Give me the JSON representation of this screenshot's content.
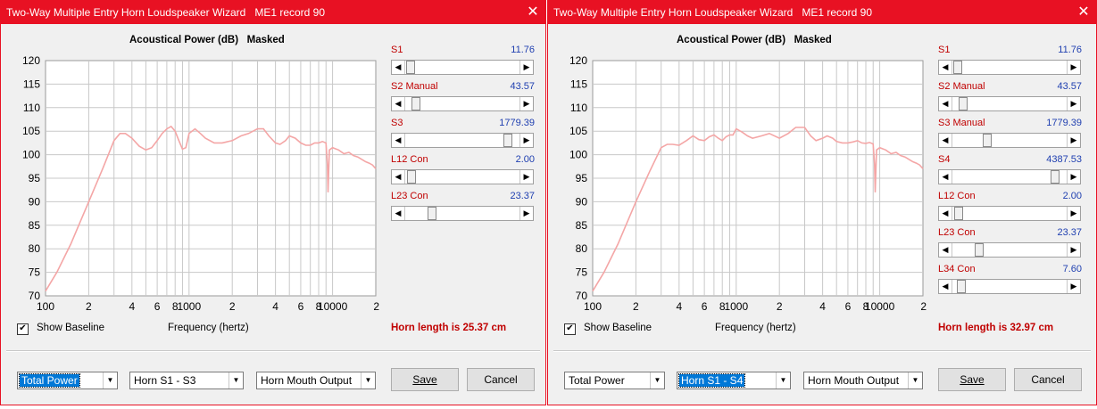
{
  "windows": [
    {
      "title": "Two-Way Multiple Entry Horn Loudspeaker Wizard   ME1 record 90",
      "chart_title": "Acoustical Power (dB)   Masked",
      "sliders": [
        {
          "label": "S1",
          "value": "11.76",
          "position": 0.01
        },
        {
          "label": "S2  Manual",
          "value": "43.57",
          "position": 0.06
        },
        {
          "label": "S3",
          "value": "1779.39",
          "position": 0.92
        },
        {
          "label": "L12  Con",
          "value": "2.00",
          "position": 0.02
        },
        {
          "label": "L23  Con",
          "value": "23.37",
          "position": 0.21
        }
      ],
      "show_baseline_checked": true,
      "show_baseline_label": "Show Baseline",
      "frequency_label": "Frequency (hertz)",
      "horn_length": "Horn length is 25.37 cm",
      "combos": [
        {
          "value": "Total Power",
          "selected": true
        },
        {
          "value": "Horn S1 - S3",
          "selected": false
        },
        {
          "value": "Horn Mouth Output",
          "selected": false
        }
      ],
      "save_label": "Save",
      "cancel_label": "Cancel"
    },
    {
      "title": "Two-Way Multiple Entry Horn Loudspeaker Wizard   ME1 record 90",
      "chart_title": "Acoustical Power (dB)   Masked",
      "sliders": [
        {
          "label": "S1",
          "value": "11.76",
          "position": 0.01
        },
        {
          "label": "S2  Manual",
          "value": "43.57",
          "position": 0.06
        },
        {
          "label": "S3  Manual",
          "value": "1779.39",
          "position": 0.28
        },
        {
          "label": "S4",
          "value": "4387.53",
          "position": 0.92
        },
        {
          "label": "L12  Con",
          "value": "2.00",
          "position": 0.02
        },
        {
          "label": "L23  Con",
          "value": "23.37",
          "position": 0.21
        },
        {
          "label": "L34  Con",
          "value": "7.60",
          "position": 0.04
        }
      ],
      "show_baseline_checked": true,
      "show_baseline_label": "Show Baseline",
      "frequency_label": "Frequency (hertz)",
      "horn_length": "Horn length is 32.97 cm",
      "combos": [
        {
          "value": "Total Power",
          "selected": false
        },
        {
          "value": "Horn S1 - S4",
          "selected": true
        },
        {
          "value": "Horn Mouth Output",
          "selected": false
        }
      ],
      "save_label": "Save",
      "cancel_label": "Cancel"
    }
  ],
  "chart_data": [
    {
      "type": "line",
      "title": "Acoustical Power (dB)   Masked",
      "xlabel": "Frequency (hertz)",
      "ylabel": "",
      "xscale": "log",
      "xlim": [
        100,
        20000
      ],
      "ylim": [
        70,
        120
      ],
      "yticks": [
        "120",
        "115",
        "110",
        "105",
        "100",
        "95",
        "90",
        "85",
        "80",
        "75",
        "70"
      ],
      "xticks": [
        "100",
        "2",
        "4",
        "6",
        "8",
        "1000",
        "2",
        "4",
        "6",
        "8",
        "10000",
        "2"
      ],
      "line_color": "#f4a6a6",
      "series": [
        {
          "x": [
            100,
            120,
            150,
            200,
            250,
            300,
            330,
            360,
            400,
            450,
            500,
            550,
            600,
            650,
            700,
            750,
            800,
            850,
            900,
            950,
            1000,
            1100,
            1200,
            1300,
            1500,
            1700,
            2000,
            2300,
            2600,
            3000,
            3300,
            3600,
            4000,
            4300,
            4700,
            5000,
            5500,
            6000,
            6500,
            7000,
            7500,
            8000,
            8500,
            9000,
            9200,
            9300,
            9500,
            10000,
            11000,
            12000,
            13000,
            14000,
            15000,
            16000,
            17000,
            18000,
            19000,
            20000
          ],
          "y": [
            71,
            75,
            81,
            90,
            97,
            103,
            104.5,
            104.5,
            103.5,
            101.8,
            101,
            101.5,
            103,
            104.5,
            105.5,
            106,
            105,
            103,
            101.2,
            101.5,
            104.5,
            105.5,
            104.5,
            103.5,
            102.5,
            102.5,
            103,
            104,
            104.5,
            105.5,
            105.5,
            104,
            102.5,
            102.2,
            103,
            104,
            103.5,
            102.5,
            102,
            102,
            102.5,
            102.5,
            102.8,
            102.5,
            98,
            92,
            101,
            101.5,
            101,
            100.2,
            100.5,
            99.8,
            99.5,
            99,
            98.5,
            98.2,
            97.8,
            97
          ]
        }
      ]
    },
    {
      "type": "line",
      "title": "Acoustical Power (dB)   Masked",
      "xlabel": "Frequency (hertz)",
      "ylabel": "",
      "xscale": "log",
      "xlim": [
        100,
        20000
      ],
      "ylim": [
        70,
        120
      ],
      "yticks": [
        "120",
        "115",
        "110",
        "105",
        "100",
        "95",
        "90",
        "85",
        "80",
        "75",
        "70"
      ],
      "xticks": [
        "100",
        "2",
        "4",
        "6",
        "8",
        "1000",
        "2",
        "4",
        "6",
        "8",
        "10000",
        "2"
      ],
      "line_color": "#f4a6a6",
      "series": [
        {
          "x": [
            100,
            120,
            150,
            200,
            250,
            300,
            330,
            360,
            400,
            450,
            500,
            550,
            600,
            650,
            700,
            750,
            800,
            850,
            900,
            950,
            1000,
            1100,
            1200,
            1300,
            1500,
            1700,
            2000,
            2300,
            2600,
            3000,
            3300,
            3600,
            4000,
            4300,
            4700,
            5000,
            5500,
            6000,
            6500,
            7000,
            7500,
            8000,
            8500,
            9000,
            9200,
            9300,
            9500,
            10000,
            11000,
            12000,
            13000,
            14000,
            15000,
            16000,
            17000,
            18000,
            19000,
            20000
          ],
          "y": [
            71,
            75,
            81,
            90,
            96.5,
            101.5,
            102.2,
            102.2,
            102,
            103,
            104,
            103.2,
            103,
            103.8,
            104.2,
            103.5,
            103,
            103.8,
            104.2,
            104.2,
            105.5,
            104.8,
            104,
            103.5,
            104,
            104.5,
            103.5,
            104.5,
            105.8,
            105.8,
            104,
            103,
            103.5,
            104,
            103.5,
            102.8,
            102.5,
            102.5,
            102.7,
            103,
            102.5,
            102.4,
            102.6,
            102.3,
            98,
            92,
            101,
            101.5,
            101,
            100.2,
            100.5,
            99.8,
            99.5,
            99,
            98.5,
            98.2,
            97.8,
            97
          ]
        }
      ]
    }
  ]
}
